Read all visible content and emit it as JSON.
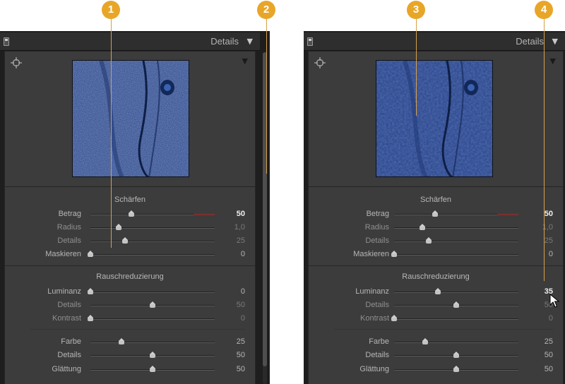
{
  "callouts": [
    "1",
    "2",
    "3",
    "4"
  ],
  "left": {
    "header_title": "Details",
    "sharpening": {
      "title": "Schärfen",
      "rows": [
        {
          "label": "Betrag",
          "value": "50",
          "fraction": 0.33
        },
        {
          "label": "Radius",
          "value": "1,0",
          "fraction": 0.23
        },
        {
          "label": "Details",
          "value": "25",
          "fraction": 0.28
        },
        {
          "label": "Maskieren",
          "value": "0",
          "fraction": 0.0
        }
      ]
    },
    "noise": {
      "title": "Rauschreduzierung",
      "rows": [
        {
          "label": "Luminanz",
          "value": "0",
          "fraction": 0.0
        },
        {
          "label": "Details",
          "value": "50",
          "fraction": 0.5
        },
        {
          "label": "Kontrast",
          "value": "0",
          "fraction": 0.0
        },
        {
          "label": "Farbe",
          "value": "25",
          "fraction": 0.25
        },
        {
          "label": "Details",
          "value": "50",
          "fraction": 0.5
        },
        {
          "label": "Glättung",
          "value": "50",
          "fraction": 0.5
        }
      ]
    }
  },
  "right": {
    "header_title": "Details",
    "sharpening": {
      "title": "Schärfen",
      "rows": [
        {
          "label": "Betrag",
          "value": "50",
          "fraction": 0.33
        },
        {
          "label": "Radius",
          "value": "1,0",
          "fraction": 0.23
        },
        {
          "label": "Details",
          "value": "25",
          "fraction": 0.28
        },
        {
          "label": "Maskieren",
          "value": "0",
          "fraction": 0.0
        }
      ]
    },
    "noise": {
      "title": "Rauschreduzierung",
      "rows": [
        {
          "label": "Luminanz",
          "value": "35",
          "fraction": 0.35
        },
        {
          "label": "Details",
          "value": "50",
          "fraction": 0.5
        },
        {
          "label": "Kontrast",
          "value": "0",
          "fraction": 0.0
        },
        {
          "label": "Farbe",
          "value": "25",
          "fraction": 0.25
        },
        {
          "label": "Details",
          "value": "50",
          "fraction": 0.5
        },
        {
          "label": "Glättung",
          "value": "50",
          "fraction": 0.5
        }
      ]
    }
  },
  "colors": {
    "callout": "#e8a628",
    "fabric": "#24407f"
  }
}
